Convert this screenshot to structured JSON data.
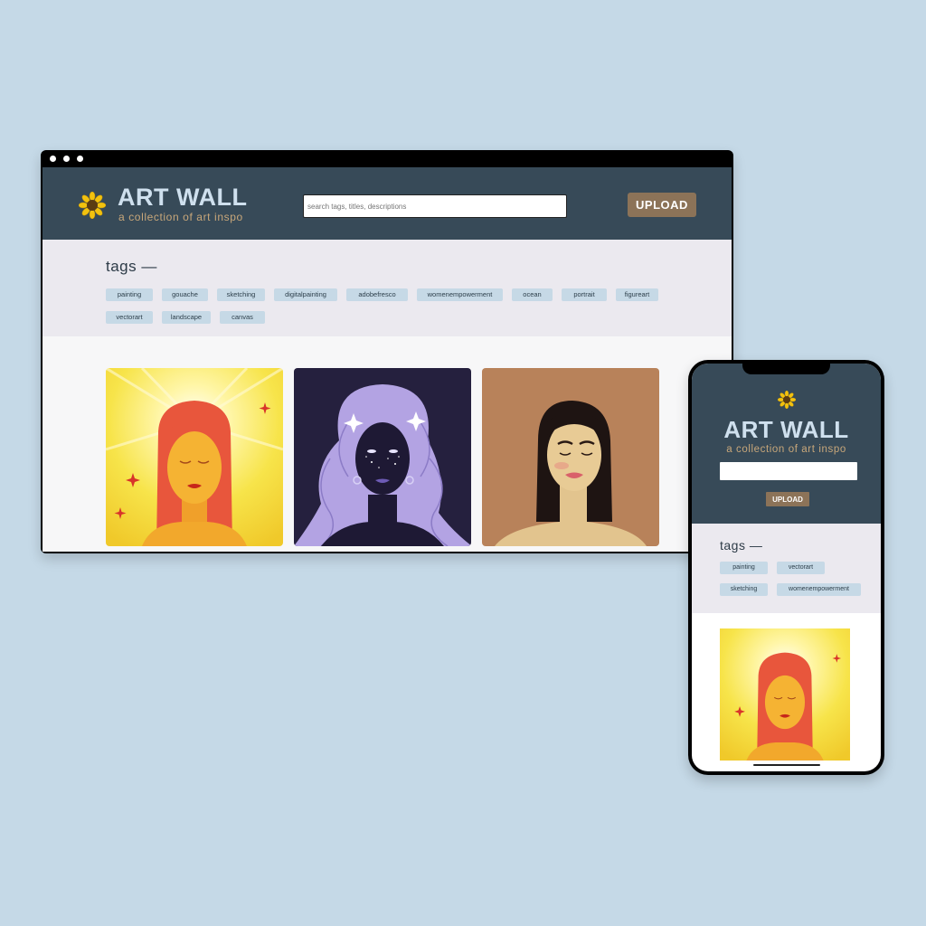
{
  "app": {
    "title": "ART WALL",
    "subtitle": "a collection of art inspo"
  },
  "desktop": {
    "search": {
      "placeholder": "search tags, titles, descriptions",
      "value": ""
    },
    "upload_label": "UPLOAD",
    "tags_heading": "tags —",
    "tags": [
      "painting",
      "gouache",
      "sketching",
      "digitalpainting",
      "adobefresco",
      "womenempowerment",
      "ocean",
      "portrait",
      "figureart",
      "vectorart",
      "landscape",
      "canvas"
    ]
  },
  "mobile": {
    "search": {
      "placeholder": "",
      "value": ""
    },
    "upload_label": "UPLOAD",
    "tags_heading": "tags —",
    "tags": [
      "painting",
      "vectorart",
      "sketching",
      "womenempowerment"
    ]
  },
  "artworks": [
    {
      "name": "sun-portrait",
      "style": "yellow radiant background, red hair"
    },
    {
      "name": "galaxy-portrait",
      "style": "dark purple background, lavender hair, stars"
    },
    {
      "name": "brunette-portrait",
      "style": "tan background, dark hair"
    }
  ],
  "colors": {
    "header_bg": "#374a58",
    "title": "#cfe0ee",
    "subtitle": "#c8a77a",
    "upload_bg": "#8c7358",
    "tags_bg": "#ebe9ef",
    "chip_bg": "#c6d9e6",
    "page_bg": "#c5d9e7"
  }
}
